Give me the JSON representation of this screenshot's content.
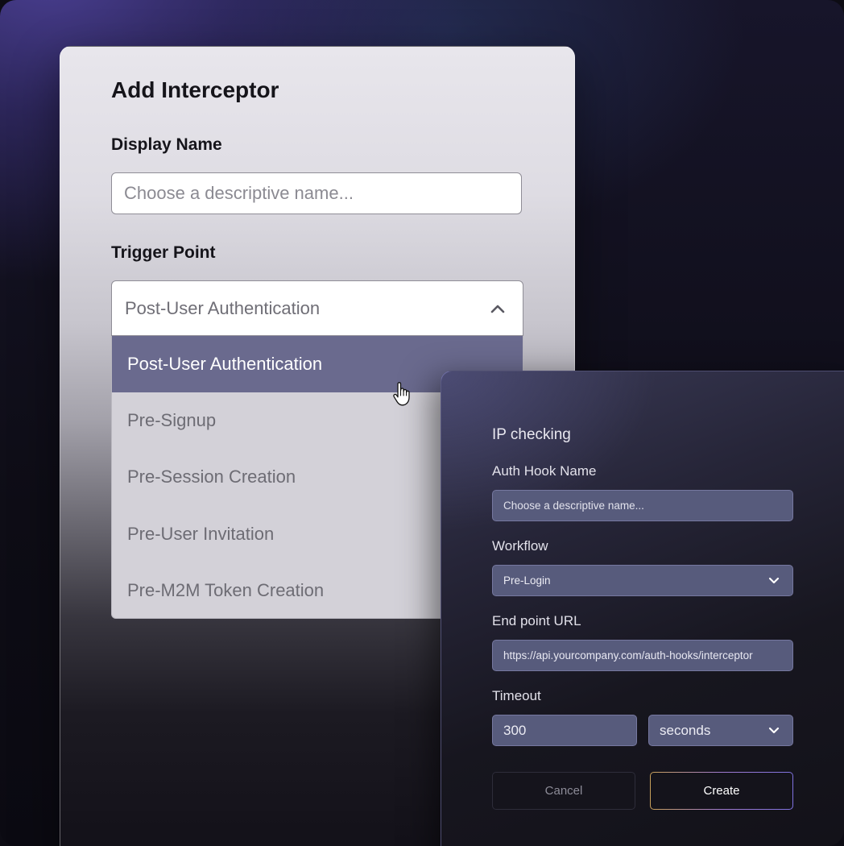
{
  "interceptor_form": {
    "title": "Add Interceptor",
    "display_name_label": "Display Name",
    "display_name_placeholder": "Choose a descriptive name...",
    "trigger_point_label": "Trigger Point",
    "trigger_point_selected": "Post-User Authentication",
    "trigger_options": [
      "Post-User Authentication",
      "Pre-Signup",
      "Pre-Session Creation",
      "Pre-User Invitation",
      "Pre-M2M Token Creation"
    ]
  },
  "auth_hook_form": {
    "title": "IP checking",
    "hook_name_label": "Auth Hook Name",
    "hook_name_placeholder": "Choose a descriptive name...",
    "workflow_label": "Workflow",
    "workflow_value": "Pre-Login",
    "endpoint_label": "End point URL",
    "endpoint_value": "https://api.yourcompany.com/auth-hooks/interceptor",
    "timeout_label": "Timeout",
    "timeout_value": "300",
    "timeout_unit": "seconds",
    "cancel_label": "Cancel",
    "create_label": "Create"
  },
  "icons": {
    "trigger_chevron": "chevron-up-icon",
    "select_chevron": "chevron-down-icon",
    "cursor": "hand-pointer-icon"
  },
  "colors": {
    "selected_option_bg": "#6a6a8e",
    "side_input_bg": "#575b7c",
    "create_border_gradient": "#c9a15a"
  }
}
